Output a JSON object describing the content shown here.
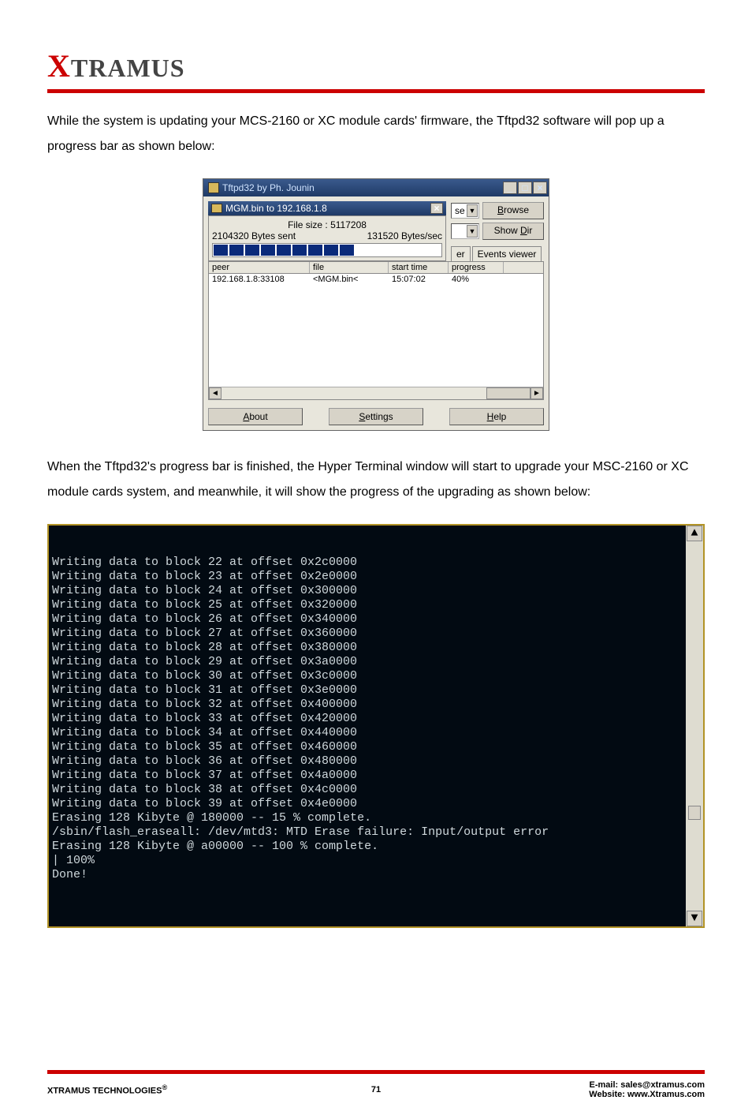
{
  "logo_prefix": "X",
  "logo_rest": "TRAMUS",
  "intro1": "While the system is updating your MCS-2160 or XC module cards' firmware, the Tftpd32 software will pop up a progress bar as shown below:",
  "tftpd": {
    "title": "Tftpd32 by Ph. Jounin",
    "dl_title": "MGM.bin to 192.168.1.8",
    "filesize": "File size : 5117208",
    "bytes_sent": "2104320 Bytes sent",
    "rate": "131520 Bytes/sec",
    "sel1": "se",
    "browse": "Browse",
    "showdir": "Show Dir",
    "tab_er": "er",
    "tab_events": "Events viewer",
    "hdr_peer": "peer",
    "hdr_file": "file",
    "hdr_start": "start time",
    "hdr_prog": "progress",
    "row_peer": "192.168.1.8:33108",
    "row_file": "<MGM.bin<",
    "row_start": "15:07:02",
    "row_prog": "40%",
    "about": "About",
    "settings": "Settings",
    "help": "Help"
  },
  "intro2": "When the Tftpd32's progress bar is finished, the Hyper Terminal window will start to upgrade your MSC-2160 or XC module cards system, and meanwhile, it will show the progress of the upgrading as shown below:",
  "terminal_lines": [
    "Writing data to block 22 at offset 0x2c0000",
    "Writing data to block 23 at offset 0x2e0000",
    "Writing data to block 24 at offset 0x300000",
    "Writing data to block 25 at offset 0x320000",
    "Writing data to block 26 at offset 0x340000",
    "Writing data to block 27 at offset 0x360000",
    "Writing data to block 28 at offset 0x380000",
    "Writing data to block 29 at offset 0x3a0000",
    "Writing data to block 30 at offset 0x3c0000",
    "Writing data to block 31 at offset 0x3e0000",
    "Writing data to block 32 at offset 0x400000",
    "Writing data to block 33 at offset 0x420000",
    "Writing data to block 34 at offset 0x440000",
    "Writing data to block 35 at offset 0x460000",
    "Writing data to block 36 at offset 0x480000",
    "Writing data to block 37 at offset 0x4a0000",
    "Writing data to block 38 at offset 0x4c0000",
    "Writing data to block 39 at offset 0x4e0000",
    "Erasing 128 Kibyte @ 180000 -- 15 % complete.",
    "/sbin/flash_eraseall: /dev/mtd3: MTD Erase failure: Input/output error",
    "Erasing 128 Kibyte @ a00000 -- 100 % complete.",
    "| 100%",
    "Done!"
  ],
  "footer": {
    "left_name": "XTRAMUS TECHNOLOGIES",
    "left_reg": "®",
    "page": "71",
    "email_label": "E-mail: ",
    "email": "sales@xtramus.com",
    "web_label": "Website:  ",
    "web": "www.Xtramus.com"
  }
}
